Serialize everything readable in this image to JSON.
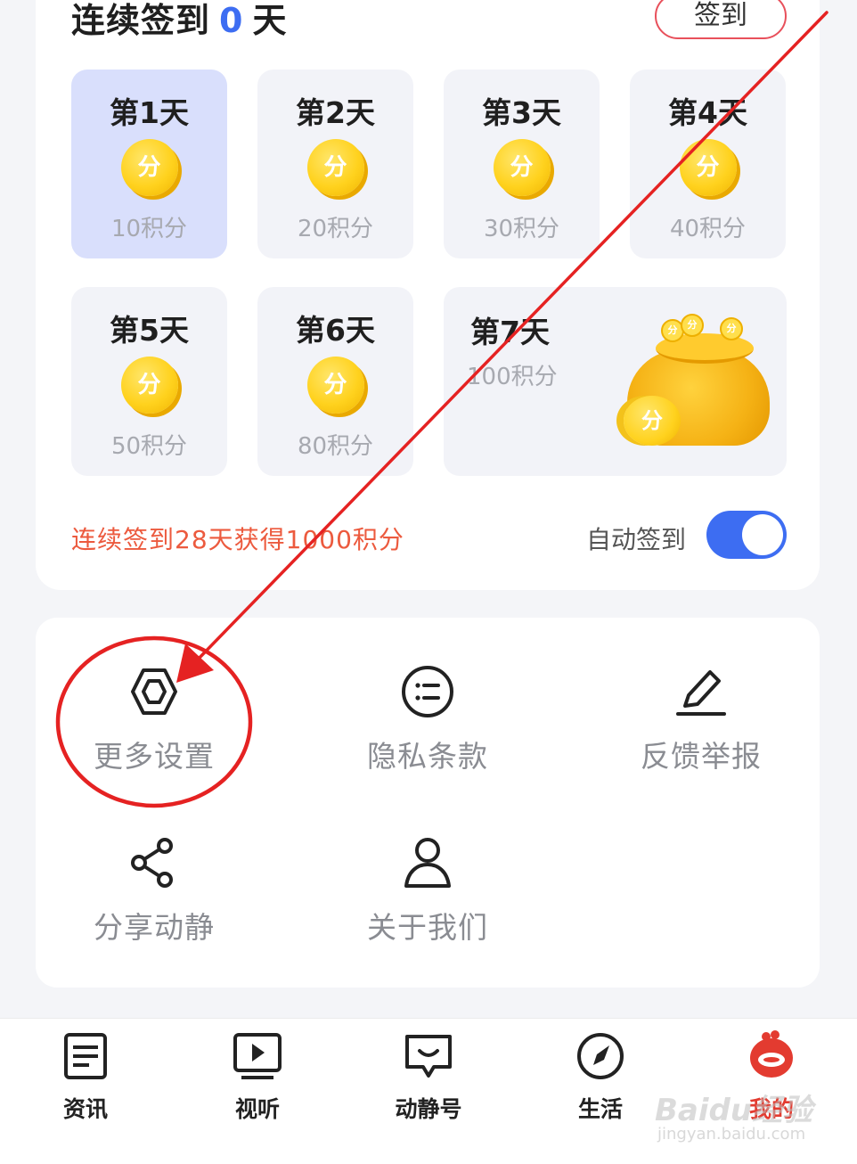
{
  "signin": {
    "title_prefix": "连续签到",
    "streak_count": "0",
    "title_suffix": "天",
    "button_label": "签到",
    "coin_glyph": "分",
    "days": [
      {
        "label": "第1天",
        "points": "10积分"
      },
      {
        "label": "第2天",
        "points": "20积分"
      },
      {
        "label": "第3天",
        "points": "30积分"
      },
      {
        "label": "第4天",
        "points": "40积分"
      },
      {
        "label": "第5天",
        "points": "50积分"
      },
      {
        "label": "第6天",
        "points": "80积分"
      },
      {
        "label": "第7天",
        "points": "100积分"
      }
    ],
    "active_day_index": 0,
    "reward_text": "连续签到28天获得1000积分",
    "auto_signin_label": "自动签到",
    "auto_signin_enabled": true
  },
  "menu": {
    "items": [
      {
        "label": "更多设置",
        "icon": "hexagon-settings-icon"
      },
      {
        "label": "隐私条款",
        "icon": "list-circle-icon"
      },
      {
        "label": "反馈举报",
        "icon": "pencil-icon"
      },
      {
        "label": "分享动静",
        "icon": "share-icon"
      },
      {
        "label": "关于我们",
        "icon": "person-icon"
      }
    ]
  },
  "bottom_nav": {
    "items": [
      {
        "label": "资讯",
        "icon": "news-icon"
      },
      {
        "label": "视听",
        "icon": "video-play-icon"
      },
      {
        "label": "动静号",
        "icon": "chat-smile-icon"
      },
      {
        "label": "生活",
        "icon": "compass-icon"
      },
      {
        "label": "我的",
        "icon": "mascot-avatar-icon"
      }
    ],
    "active_index": 4
  },
  "watermark": {
    "text": "Baidu经验",
    "sub": "jingyan.baidu.com"
  },
  "colors": {
    "accent_blue": "#3d6df2",
    "reward_red": "#ec5a3e",
    "annotation_red": "#e52222",
    "coin_yellow": "#ffd21e"
  }
}
